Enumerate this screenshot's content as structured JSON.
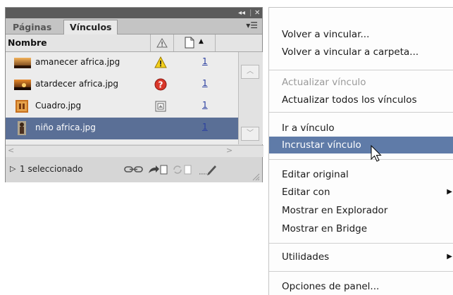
{
  "panel": {
    "tabs": [
      "Páginas",
      "Vínculos"
    ],
    "column_name": "Nombre",
    "rows": [
      {
        "name": "amanecer africa.jpg",
        "status": "warning",
        "page": "1",
        "selected": false
      },
      {
        "name": "atardecer africa.jpg",
        "status": "missing",
        "page": "1",
        "selected": false
      },
      {
        "name": "Cuadro.jpg",
        "status": "embedded",
        "page": "1",
        "selected": false
      },
      {
        "name": "niño africa.jpg",
        "status": "",
        "page": "1",
        "selected": true
      }
    ],
    "footer_status": "1 seleccionado"
  },
  "menu": {
    "items": [
      {
        "label": "Volver a vincular...",
        "disabled": false,
        "highlight": false,
        "submenu": false
      },
      {
        "label": "Volver a vincular a carpeta...",
        "disabled": false,
        "highlight": false,
        "submenu": false
      },
      {
        "label": "Actualizar vínculo",
        "disabled": true,
        "highlight": false,
        "submenu": false
      },
      {
        "label": "Actualizar todos los vínculos",
        "disabled": false,
        "highlight": false,
        "submenu": false
      },
      {
        "label": "Ir a vínculo",
        "disabled": false,
        "highlight": false,
        "submenu": false
      },
      {
        "label": "Incrustar vínculo",
        "disabled": false,
        "highlight": true,
        "submenu": false
      },
      {
        "label": "Editar original",
        "disabled": false,
        "highlight": false,
        "submenu": false
      },
      {
        "label": "Editar con",
        "disabled": false,
        "highlight": false,
        "submenu": true
      },
      {
        "label": "Mostrar en Explorador",
        "disabled": false,
        "highlight": false,
        "submenu": false
      },
      {
        "label": "Mostrar en Bridge",
        "disabled": false,
        "highlight": false,
        "submenu": false
      },
      {
        "label": "Utilidades",
        "disabled": false,
        "highlight": false,
        "submenu": true
      },
      {
        "label": "Opciones de panel...",
        "disabled": false,
        "highlight": false,
        "submenu": false
      }
    ]
  },
  "colors": {
    "selection": "#5a6f96",
    "menu_highlight": "#5f7ba8",
    "page_link": "#2a3fa0"
  }
}
